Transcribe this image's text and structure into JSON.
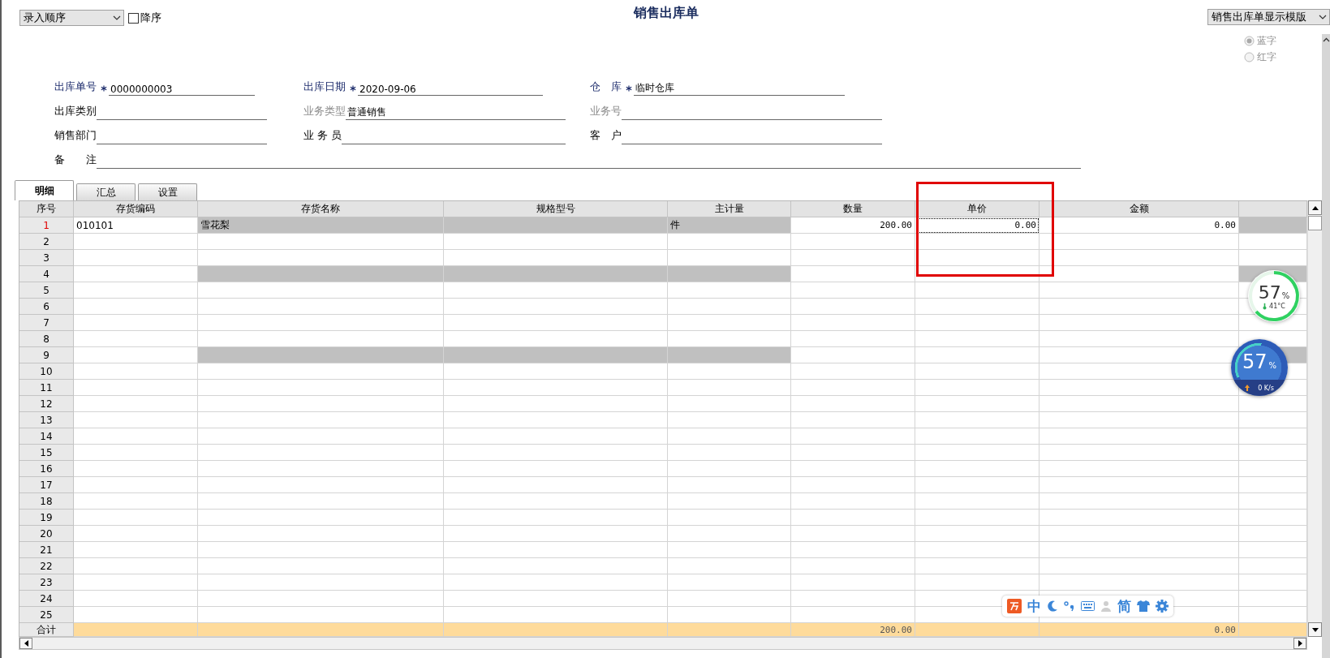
{
  "sort_select": {
    "value": "录入顺序"
  },
  "descending_checkbox": {
    "label": "降序",
    "checked": false
  },
  "title": "销售出库单",
  "template_select": {
    "value": "销售出库单显示模版"
  },
  "color_radios": {
    "disabled": true,
    "options": [
      {
        "label": "蓝字",
        "selected": true
      },
      {
        "label": "红字",
        "selected": false
      }
    ]
  },
  "form_rows": [
    [
      {
        "label": "出库单号",
        "required": true,
        "disabled": false,
        "value": "0000000003"
      },
      {
        "label": "出库日期",
        "required": true,
        "disabled": false,
        "value": "2020-09-06"
      },
      {
        "label": "仓　库",
        "required": true,
        "disabled": false,
        "value": "临时仓库"
      }
    ],
    [
      {
        "label": "出库类别",
        "required": false,
        "disabled": false
      },
      {
        "label": "业务类型",
        "required": false,
        "disabled": true,
        "value": "普通销售"
      },
      {
        "label": "业务号",
        "required": false,
        "disabled": true
      }
    ],
    [
      {
        "label": "销售部门",
        "required": false,
        "disabled": false
      },
      {
        "label": "业 务 员",
        "required": false,
        "disabled": false
      },
      {
        "label": "客　户",
        "required": false,
        "disabled": false
      }
    ],
    [
      {
        "label": "备　　注",
        "required": false,
        "disabled": false
      }
    ]
  ],
  "tabs": [
    {
      "label": "明细",
      "selected": true
    },
    {
      "label": "汇总",
      "selected": false
    },
    {
      "label": "设置",
      "selected": false
    }
  ],
  "table": {
    "columns": [
      {
        "label": "序号",
        "kind": "index"
      },
      {
        "label": "存货编码",
        "kind": "text",
        "lookup": false,
        "focused": false
      },
      {
        "label": "存货名称",
        "kind": "text",
        "lookup": true,
        "focused": false
      },
      {
        "label": "规格型号",
        "kind": "text",
        "lookup": true,
        "focused": false
      },
      {
        "label": "主计量",
        "kind": "text",
        "lookup": true,
        "focused": false
      },
      {
        "label": "数量",
        "kind": "number",
        "lookup": false,
        "focused": false
      },
      {
        "label": "单价",
        "kind": "number",
        "lookup": false,
        "focused": true
      },
      {
        "label": "金额",
        "kind": "number",
        "lookup": false,
        "focused": false
      }
    ],
    "rows": [
      {
        "number": "1",
        "selected": true,
        "shaded": true,
        "cells": [
          "010101",
          "雪花梨",
          null,
          "件",
          "200.00",
          "0.00",
          "0.00"
        ]
      },
      {
        "number": "2",
        "selected": false,
        "shaded": false
      },
      {
        "number": "3",
        "selected": false,
        "shaded": false
      },
      {
        "number": "4",
        "selected": false,
        "shaded": true
      },
      {
        "number": "5",
        "selected": false,
        "shaded": false
      },
      {
        "number": "6",
        "selected": false,
        "shaded": false
      },
      {
        "number": "7",
        "selected": false,
        "shaded": false
      },
      {
        "number": "8",
        "selected": false,
        "shaded": false
      },
      {
        "number": "9",
        "selected": false,
        "shaded": true
      },
      {
        "number": "10",
        "selected": false,
        "shaded": false
      },
      {
        "number": "11",
        "selected": false,
        "shaded": false
      },
      {
        "number": "12",
        "selected": false,
        "shaded": false
      },
      {
        "number": "13",
        "selected": false,
        "shaded": false
      },
      {
        "number": "14",
        "selected": false,
        "shaded": false
      },
      {
        "number": "15",
        "selected": false,
        "shaded": false
      },
      {
        "number": "16",
        "selected": false,
        "shaded": false
      },
      {
        "number": "17",
        "selected": false,
        "shaded": false
      },
      {
        "number": "18",
        "selected": false,
        "shaded": false
      },
      {
        "number": "19",
        "selected": false,
        "shaded": false
      },
      {
        "number": "20",
        "selected": false,
        "shaded": false
      },
      {
        "number": "21",
        "selected": false,
        "shaded": false
      },
      {
        "number": "22",
        "selected": false,
        "shaded": false
      },
      {
        "number": "23",
        "selected": false,
        "shaded": false
      },
      {
        "number": "24",
        "selected": false,
        "shaded": false
      },
      {
        "number": "25",
        "selected": false,
        "shaded": false
      }
    ],
    "total": {
      "label": "合计",
      "cells": [
        null,
        null,
        null,
        null,
        "200.00",
        null,
        "0.00"
      ]
    }
  },
  "memory_widget": {
    "value": "57",
    "unit": "%",
    "temperature": "41°C"
  },
  "network_widget": {
    "value": "57",
    "unit": "%",
    "speed": "0 K/s"
  },
  "ime_toolbar": {
    "mode": "中",
    "charset": "简"
  }
}
